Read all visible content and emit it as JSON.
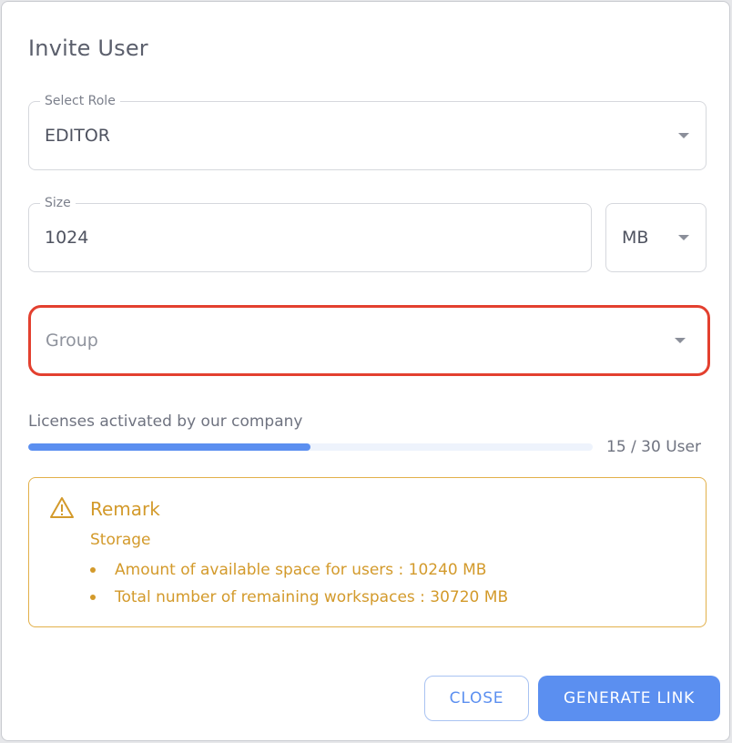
{
  "dialog": {
    "title": "Invite User"
  },
  "role": {
    "label": "Select Role",
    "value": "EDITOR"
  },
  "size": {
    "label": "Size",
    "value": "1024",
    "unit": "MB"
  },
  "group": {
    "placeholder": "Group"
  },
  "licenses": {
    "label": "Licenses activated by our company",
    "count_text": "15 / 30 User",
    "progress_fraction": 0.5
  },
  "remark": {
    "title": "Remark",
    "subtitle": "Storage",
    "items": [
      "Amount of available space for users : 10240 MB",
      "Total number of remaining workspaces : 30720 MB"
    ]
  },
  "buttons": {
    "close": "CLOSE",
    "generate": "GENERATE LINK"
  },
  "colors": {
    "accent": "#5b8ff0",
    "warning": "#d39a2b",
    "highlight": "#e3402f"
  },
  "icons": {
    "dropdown": "chevron-down-icon",
    "remark": "warning-icon"
  }
}
